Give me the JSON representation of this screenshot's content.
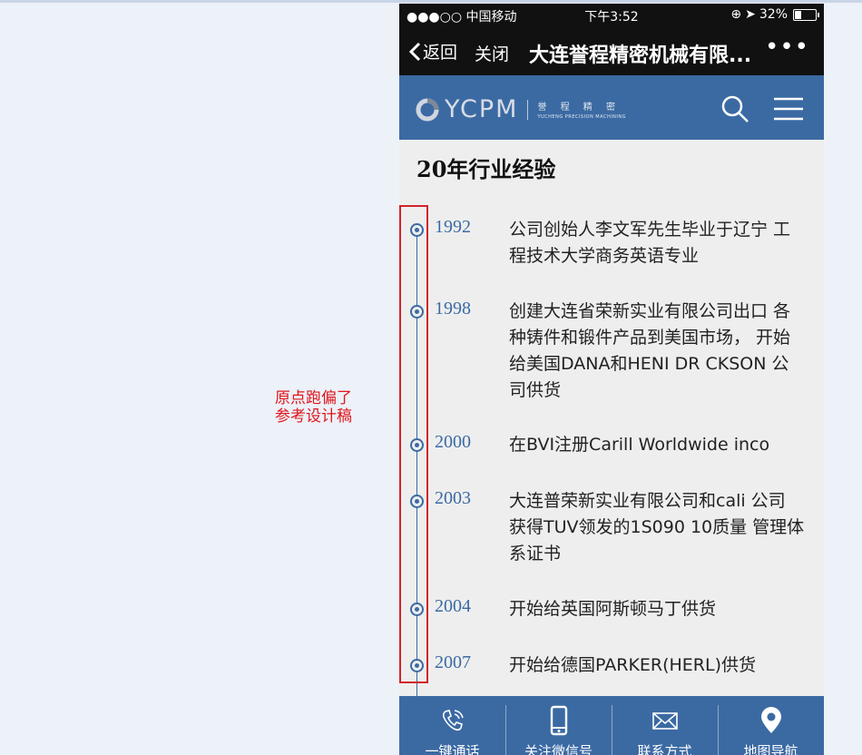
{
  "annotation": {
    "lines": [
      "原点跑偏了",
      "参考设计稿"
    ],
    "color": "#e0161c"
  },
  "statusbar": {
    "carrier": "●●●○○ 中国移动",
    "time": "下午3:52",
    "battery_text": "32%",
    "battery_level": 0.32
  },
  "navbar": {
    "back_label": "返回",
    "close_label": "关闭",
    "title": "大连誉程精密机械有限...",
    "more_label": "•••"
  },
  "header": {
    "logo_text": "YCPM",
    "logo_sub_cn": "誉 程 精 密",
    "logo_sub_en": "YUCHENG PRECISION MACHINING",
    "bg_color": "#3b6aa3"
  },
  "section": {
    "title": "20年行业经验"
  },
  "timeline": [
    {
      "year": "1992",
      "lines": [
        "公司创始人李文军先生毕业于辽宁 工",
        "程技术大学商务英语专业"
      ]
    },
    {
      "year": "1998",
      "lines": [
        "创建大连省荣新实业有限公司出口 各",
        "种铸件和锻件产品到美国市场， 开始",
        "给美国DANA和HENI DR CKSON 公",
        "司供货"
      ]
    },
    {
      "year": "2000",
      "lines": [
        "在BVI注册Carill Worldwide inco"
      ]
    },
    {
      "year": "2003",
      "lines": [
        "大连普荣新实业有限公司和cali 公司",
        "获得TUV领发的1S090 10质量 管理体",
        "系证书"
      ]
    },
    {
      "year": "2004",
      "lines": [
        "开始给英国阿斯顿马丁供货"
      ]
    },
    {
      "year": "2007",
      "lines": [
        "开始给德国PARKER(HERL)供货"
      ]
    }
  ],
  "bottom_bar": [
    {
      "label": "一键通话",
      "icon": "phone-icon"
    },
    {
      "label": "关注微信号",
      "icon": "mobile-icon"
    },
    {
      "label": "联系方式",
      "icon": "mail-icon"
    },
    {
      "label": "地图导航",
      "icon": "map-pin-icon"
    }
  ]
}
